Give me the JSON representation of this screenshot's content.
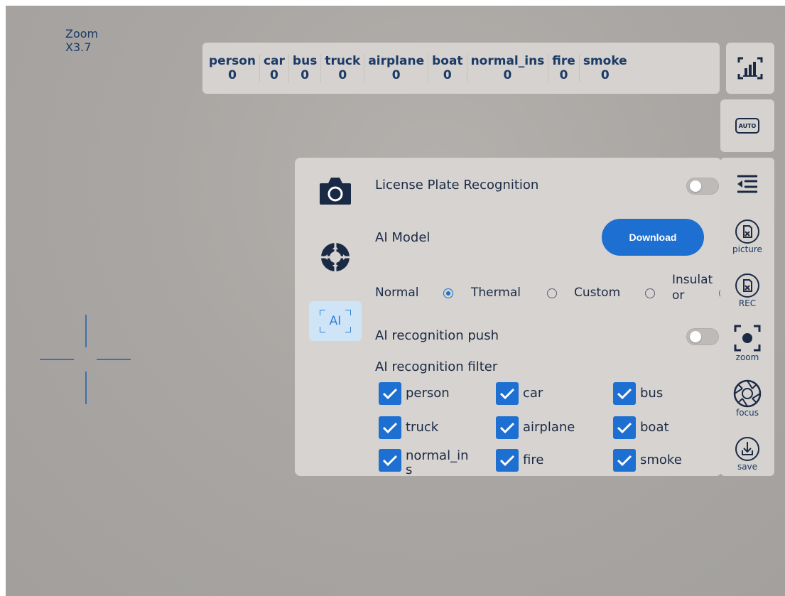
{
  "zoom": {
    "label": "Zoom",
    "value": "X3.7"
  },
  "counters": [
    {
      "label": "person",
      "value": "0"
    },
    {
      "label": "car",
      "value": "0"
    },
    {
      "label": "bus",
      "value": "0"
    },
    {
      "label": "truck",
      "value": "0"
    },
    {
      "label": "airplane",
      "value": "0"
    },
    {
      "label": "boat",
      "value": "0"
    },
    {
      "label": "normal_ins",
      "value": "0"
    },
    {
      "label": "fire",
      "value": "0"
    },
    {
      "label": "smoke",
      "value": "0"
    }
  ],
  "top_buttons": {
    "stats_icon": "bar-chart-icon",
    "auto_label": "AUTO"
  },
  "panel": {
    "side_tabs": [
      {
        "icon": "camera-icon"
      },
      {
        "icon": "direction-pad-icon"
      },
      {
        "label": "AI",
        "active": true
      }
    ],
    "license_plate": {
      "label": "License Plate Recognition",
      "enabled": false
    },
    "ai_model": {
      "label": "AI Model",
      "download_label": "Download"
    },
    "model_options": [
      {
        "label": "Normal",
        "selected": true
      },
      {
        "label": "Thermal",
        "selected": false
      },
      {
        "label": "Custom",
        "selected": false
      },
      {
        "label_line1": "Insulat",
        "label_line2": "or",
        "selected": false
      }
    ],
    "push": {
      "label": "AI recognition push",
      "enabled": false
    },
    "filter": {
      "label": "AI recognition filter",
      "items": [
        {
          "label": "person",
          "checked": true
        },
        {
          "label": "car",
          "checked": true
        },
        {
          "label": "bus",
          "checked": true
        },
        {
          "label": "truck",
          "checked": true
        },
        {
          "label": "airplane",
          "checked": true
        },
        {
          "label": "boat",
          "checked": true
        },
        {
          "label_line1": "normal_in",
          "label_line2": "s",
          "checked": true
        },
        {
          "label": "fire",
          "checked": true
        },
        {
          "label": "smoke",
          "checked": true
        }
      ]
    }
  },
  "toolbar": {
    "menu_icon": "collapse-menu-icon",
    "picture_label": "picture",
    "rec_label": "REC",
    "zoom_label": "zoom",
    "focus_label": "focus",
    "save_label": "save"
  },
  "colors": {
    "accent": "#1e6fd2",
    "crosshair": "#3e6fb1",
    "text": "#1b2a44"
  }
}
